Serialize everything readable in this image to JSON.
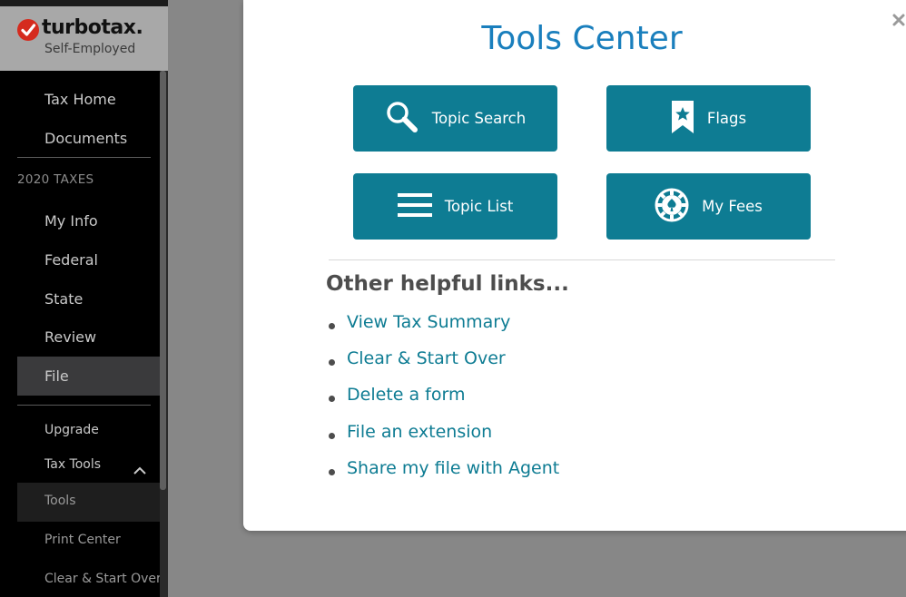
{
  "brand": {
    "name": "turbotax.",
    "edition": "Self-Employed"
  },
  "sidebar": {
    "section_label": "2020 TAXES",
    "items": [
      {
        "label": "Tax Home"
      },
      {
        "label": "Documents"
      },
      {
        "label": "My Info"
      },
      {
        "label": "Federal"
      },
      {
        "label": "State"
      },
      {
        "label": "Review"
      },
      {
        "label": "File",
        "selected": true
      }
    ],
    "sub_items": [
      {
        "label": "Upgrade"
      },
      {
        "label": "Tax Tools",
        "expanded": true
      },
      {
        "label": "Tools",
        "selected": true
      },
      {
        "label": "Print Center"
      },
      {
        "label": "Clear & Start Over"
      }
    ]
  },
  "modal": {
    "title": "Tools Center",
    "close_icon": "close-icon",
    "tiles": [
      {
        "label": "Topic Search",
        "icon": "search-icon"
      },
      {
        "label": "Flags",
        "icon": "bookmark-star-icon"
      },
      {
        "label": "Topic List",
        "icon": "menu-icon"
      },
      {
        "label": "My Fees",
        "icon": "fees-chip-icon"
      }
    ],
    "links_heading": "Other helpful links...",
    "links": [
      {
        "label": "View Tax Summary"
      },
      {
        "label": "Clear & Start Over"
      },
      {
        "label": "Delete a form"
      },
      {
        "label": "File an extension"
      },
      {
        "label": "Share my file with Agent"
      }
    ]
  },
  "colors": {
    "accent": "#0e7c93",
    "title": "#1a7fbd",
    "logo_red": "#d52b1e",
    "sidebar_bg": "#000000",
    "backdrop": "#878787"
  }
}
